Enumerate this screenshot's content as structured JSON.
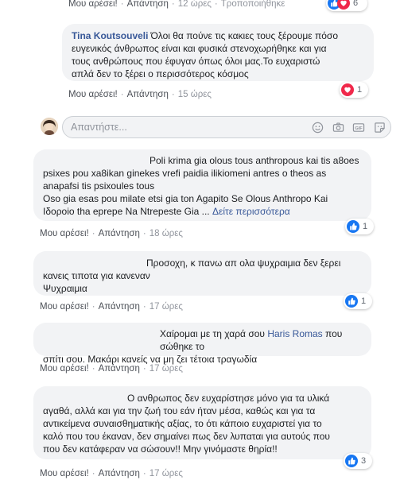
{
  "comments": [
    {
      "actions": {
        "like": "Μου αρέσει!",
        "reply": "Απάντηση",
        "time": "12 ώρες",
        "extra": "Τροποποιήθηκε"
      },
      "reaction_count": "6"
    },
    {
      "author": "Tina Koutsouveli",
      "text_lines": [
        "Όλοι θα πούνε τις κακιες τους ξέρουμε πόσο",
        "ευγενικός άνθρωπος είναι και φυσικά στενοχωρήθηκε και για",
        "τους ανθρώπους που έφυγαν όπως όλοι μας.Το ευχαριστώ",
        "απλά δεν το ξέρει ο περισσότερος κόσμος"
      ],
      "actions": {
        "like": "Μου αρέσει!",
        "reply": "Απάντηση",
        "time": "15 ώρες"
      },
      "reaction_count": "1"
    },
    {
      "text_lines": [
        "Poli krima gia olous tous anthropous kai tis a8oes",
        "psixes pou xa8ikan ginekes vrefi paidia ilikiomeni antres o theos as",
        "anapafsi tis psixoules tous",
        "Oso gia esas pou milate etsi gia ton Agapito Se Olous Anthropo Kai",
        "Ιδoροio tha eprepe Na Ntrepeste Gia ..."
      ],
      "see_more": "Δείτε περισσότερα",
      "actions": {
        "like": "Μου αρέσει!",
        "reply": "Απάντηση",
        "time": "18 ώρες"
      },
      "reaction_count": "1"
    },
    {
      "text_lines": [
        "Προσοχη, κ πανω απ ολα ψυχραιμια δεν ξερει",
        "κανεις τιποτα για κανεναν",
        "Ψυχραιμια"
      ],
      "actions": {
        "like": "Μου αρέσει!",
        "reply": "Απάντηση",
        "time": "17 ώρες"
      },
      "reaction_count": "1"
    },
    {
      "text_before": "Χαίρομαι με τη χαρά σου",
      "mention": "Haris Romas",
      "text_after": "που σώθηκε το",
      "text_line2": "σπίτι σου. Μακάρι κανείς να μη ζει τέτοια τραγωδία",
      "actions": {
        "like": "Μου αρέσει!",
        "reply": "Απάντηση",
        "time": "17 ώρες"
      }
    },
    {
      "text_lines": [
        "Ο ανθρωπος δεν ευχαρίστησε μόνο για τα υλικά",
        "αγαθά, αλλά και για την ζωή του εάν ήταν μέσα, καθώς και για τα",
        "αντικείμενα συναισθηματικής αξίας, το ότι κάποιο ευχαριστεί για το",
        "καλό που του έκαναν, δεν σημαίνει πως δεν λυπαται για αυτούς που",
        "που δεν κατάφεραν να σώσουν!! Μην γινόμαστε θηρία!!"
      ],
      "actions": {
        "like": "Μου αρέσει!",
        "reply": "Απάντηση",
        "time": "17 ώρες"
      },
      "reaction_count": "3"
    }
  ],
  "reply_box": {
    "placeholder": "Απαντήστε..."
  },
  "icons": {
    "emoji": "smiley-icon",
    "camera": "camera-icon",
    "gif": "gif-icon",
    "sticker": "sticker-icon"
  },
  "colors": {
    "link": "#385898",
    "like_blue": "#1877f2",
    "love_red": "#f0284a",
    "bubble": "#f2f3f5"
  }
}
